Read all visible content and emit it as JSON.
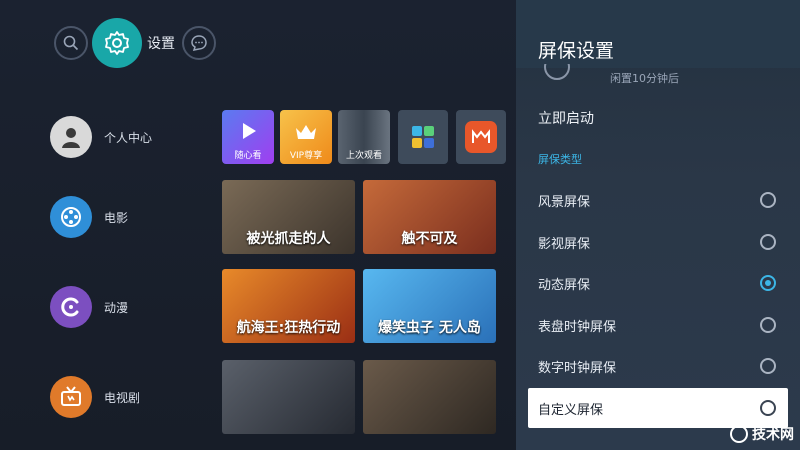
{
  "topbar": {
    "settings_label": "设置",
    "icons": [
      "search-icon",
      "gear-icon",
      "message-icon"
    ]
  },
  "nav": {
    "items": [
      {
        "label": "个人中心",
        "icon": "avatar",
        "color": "#d9d9d9"
      },
      {
        "label": "电影",
        "icon": "film-reel-icon",
        "color": "#2f8fd8"
      },
      {
        "label": "动漫",
        "icon": "anime-icon",
        "color": "#7c4fc0"
      },
      {
        "label": "电视剧",
        "icon": "tv-icon",
        "color": "#e07a2a"
      }
    ]
  },
  "apps": {
    "tiles": [
      {
        "caption": "随心看",
        "color": "#7a3cf0"
      },
      {
        "caption": "VIP尊享",
        "color": "#f0a020"
      },
      {
        "caption": "上次观看",
        "color": "#44505e"
      },
      {
        "caption": "",
        "color": "#3e4b5b"
      },
      {
        "caption": "",
        "color": "#e8572a"
      }
    ]
  },
  "posters": [
    {
      "title": "被光抓走的人",
      "color": "#5a4a3c"
    },
    {
      "title": "触不可及",
      "color": "#a8482c"
    },
    {
      "title": "航海王:狂热行动",
      "color": "#c25420"
    },
    {
      "title": "爆笑虫子 无人岛",
      "color": "#2c8ad0"
    },
    {
      "title": "",
      "color": "#3a3f48"
    },
    {
      "title": "",
      "color": "#4a4038"
    }
  ],
  "panel": {
    "title": "屏保设置",
    "peek_text": "闲置10分钟后",
    "start_now": "立即启动",
    "section_label": "屏保类型",
    "options": [
      {
        "label": "风景屏保",
        "checked": false,
        "focused": false
      },
      {
        "label": "影视屏保",
        "checked": false,
        "focused": false
      },
      {
        "label": "动态屏保",
        "checked": true,
        "focused": false
      },
      {
        "label": "表盘时钟屏保",
        "checked": false,
        "focused": false
      },
      {
        "label": "数字时钟屏保",
        "checked": false,
        "focused": false
      },
      {
        "label": "自定义屏保",
        "checked": false,
        "focused": true
      }
    ],
    "accent_color": "#3cb6e6"
  },
  "watermark": {
    "text": "技术网"
  }
}
